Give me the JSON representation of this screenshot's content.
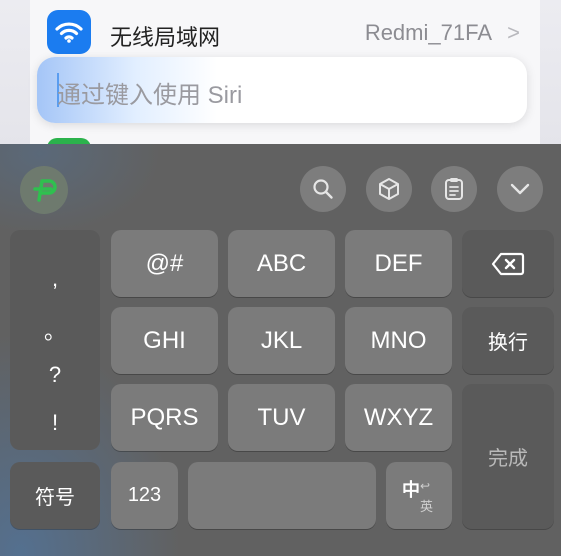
{
  "settings": {
    "wifi_label": "无线局域网",
    "wifi_value": "Redmi_71FA",
    "chevron": ">"
  },
  "siri": {
    "placeholder": "通过键入使用 Siri"
  },
  "toolbar": {
    "icons": [
      "p-logo-icon",
      "search-icon",
      "cube-icon",
      "clipboard-icon",
      "chevron-down-icon"
    ]
  },
  "keyboard": {
    "punctuation": [
      ",",
      "。",
      "?",
      "!"
    ],
    "keys_row1": [
      "@#",
      "ABC",
      "DEF"
    ],
    "keys_row2": [
      "GHI",
      "JKL",
      "MNO"
    ],
    "keys_row3": [
      "PQRS",
      "TUV",
      "WXYZ"
    ],
    "newline": "换行",
    "done": "完成",
    "symbols": "符号",
    "numbers": "123",
    "lang_zh": "中",
    "lang_en": "英"
  },
  "colors": {
    "wifi_blue": "#1b7cf0",
    "logo_green": "#2fc04f",
    "keyboard_bg": "#616161",
    "key_bg": "#7b7b7b"
  }
}
